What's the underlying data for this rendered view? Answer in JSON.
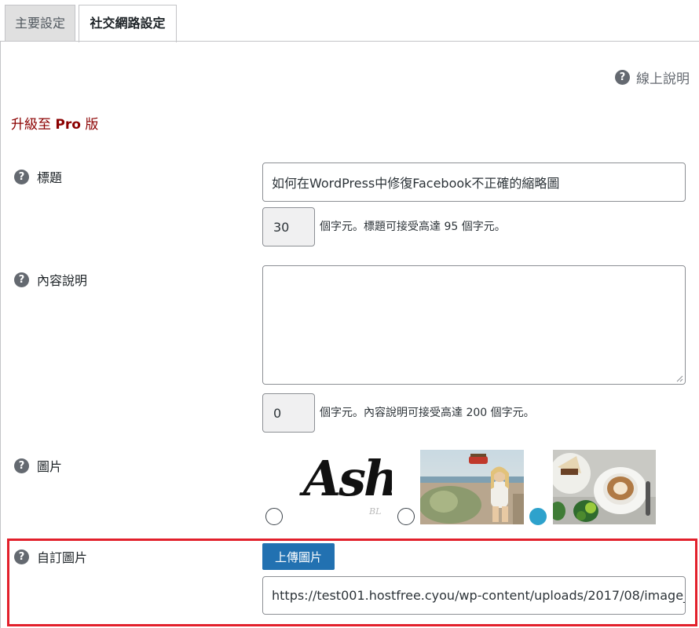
{
  "tabs": [
    {
      "label": "主要設定",
      "active": false
    },
    {
      "label": "社交網路設定",
      "active": true
    }
  ],
  "help_link": {
    "label": "線上說明",
    "icon": "question-circle-icon"
  },
  "upgrade": {
    "prefix": "升級至 ",
    "bold": "Pro",
    "suffix": " 版"
  },
  "fields": {
    "title": {
      "label": "標題",
      "value": "如何在WordPress中修復Facebook不正確的縮略圖",
      "count": "30",
      "hint": "個字元。標題可接受高達 95 個字元。"
    },
    "description": {
      "label": "內容說明",
      "value": "",
      "count": "0",
      "hint": "個字元。內容說明可接受高達 200 個字元。"
    },
    "image": {
      "label": "圖片",
      "options": [
        {
          "name": "ashe-logo",
          "caption": "Ashe",
          "caption_small": "BL",
          "selected": false
        },
        {
          "name": "girl-on-car-photo",
          "selected": false
        },
        {
          "name": "latte-and-cake-photo",
          "selected": true
        }
      ]
    },
    "custom_image": {
      "label": "自訂圖片",
      "button": "上傳圖片",
      "url": "https://test001.hostfree.cyou/wp-content/uploads/2017/08/image_"
    }
  },
  "colors": {
    "accent": "#2271b1",
    "upgrade": "#8b0000",
    "highlight": "#e2202b",
    "radio_selected": "#2ea2cc"
  }
}
